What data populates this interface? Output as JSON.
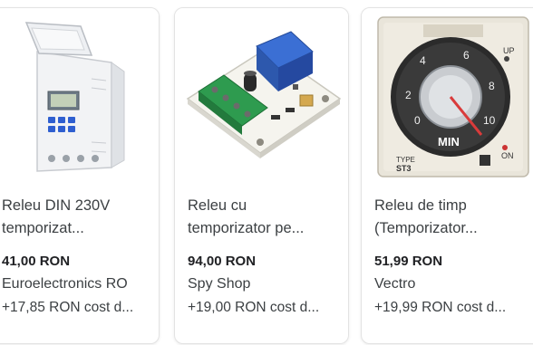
{
  "products": [
    {
      "image_icon": "din-rail-timer-relay-icon",
      "title_line1": "Releu DIN 230V",
      "title_line2": "temporizat...",
      "price": "41,00 RON",
      "merchant": "Euroelectronics RO",
      "shipping": "+17,85 RON cost d..."
    },
    {
      "image_icon": "relay-module-board-icon",
      "title_line1": "Releu cu",
      "title_line2": "temporizator pe...",
      "price": "94,00 RON",
      "merchant": "Spy Shop",
      "shipping": "+19,00 RON cost d..."
    },
    {
      "image_icon": "analog-timer-dial-icon",
      "title_line1": "Releu de timp",
      "title_line2": "(Temporizator...",
      "price": "51,99 RON",
      "merchant": "Vectro",
      "shipping": "+19,99 RON cost d...",
      "image_text": {
        "label_up": "UP",
        "label_min": "MIN",
        "label_on": "ON",
        "type_line1": "TYPE",
        "type_line2": "ST3",
        "dial_numbers": [
          "0",
          "2",
          "4",
          "6",
          "8",
          "10"
        ]
      }
    }
  ],
  "colors": {
    "text": "#3c4043",
    "price": "#202124",
    "card_border": "#e3e3e3"
  }
}
